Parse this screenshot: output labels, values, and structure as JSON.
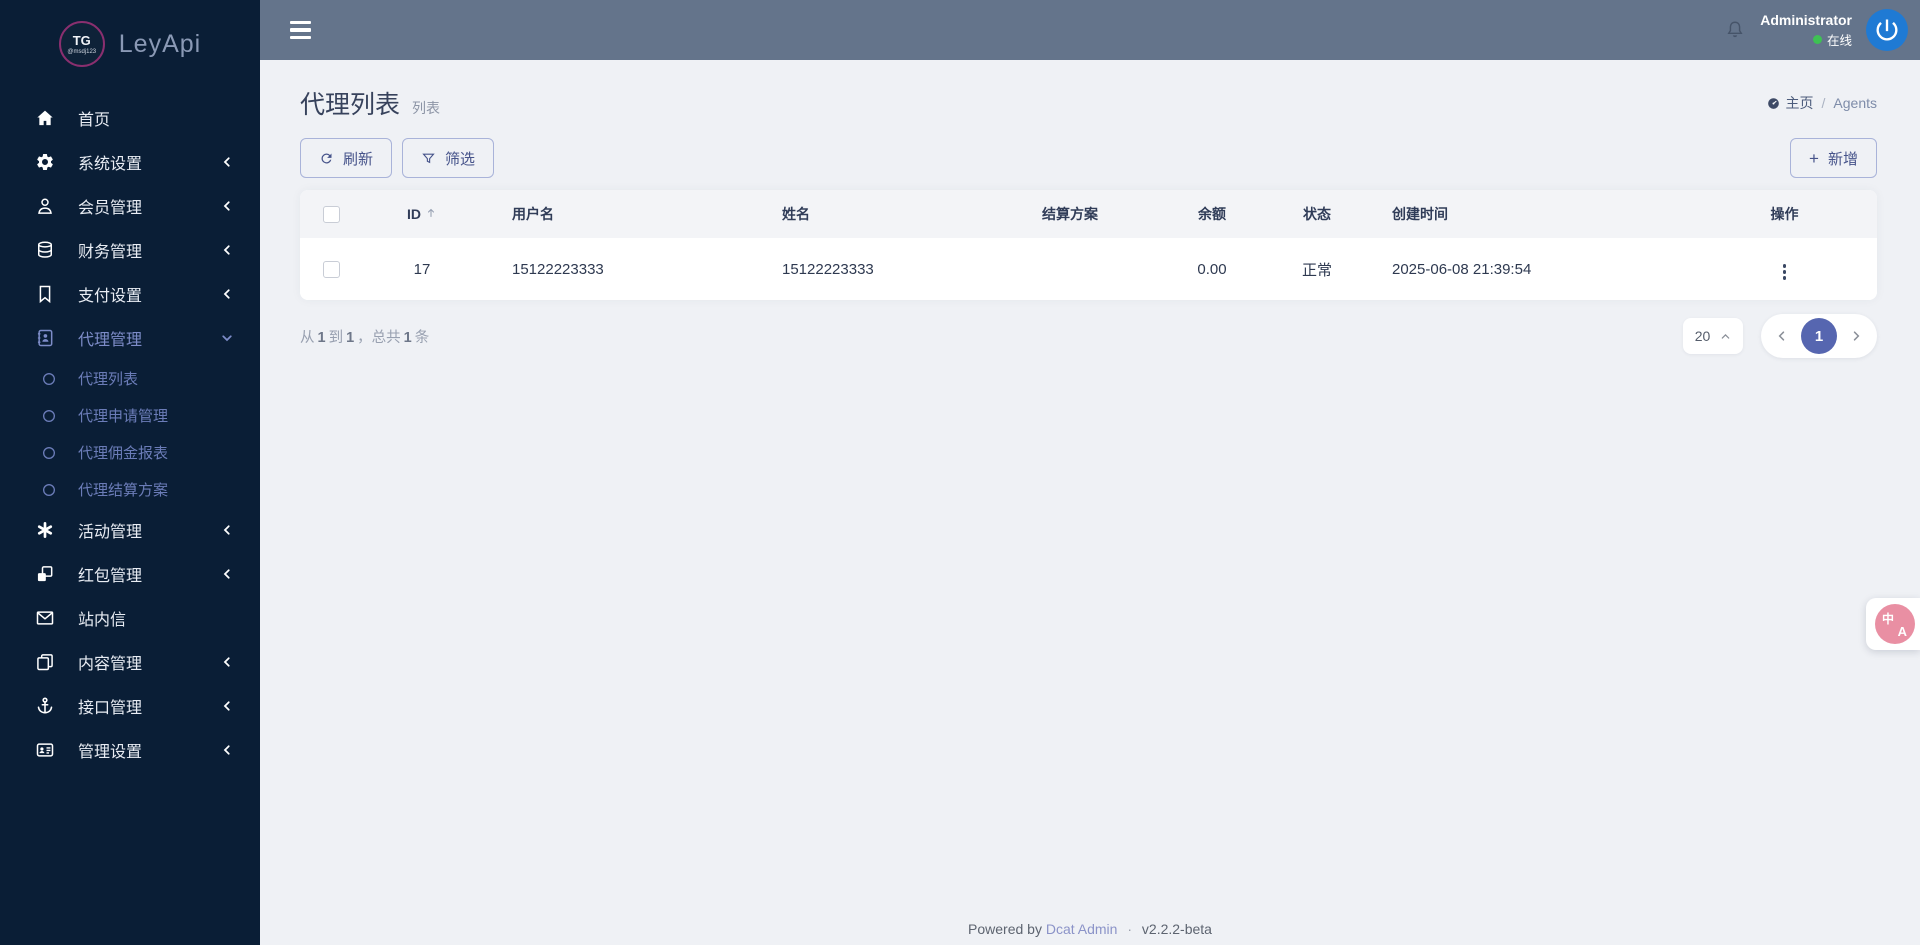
{
  "brand": {
    "badge_top": "TG",
    "badge_sub": "@msdj123",
    "app_name": "LeyApi"
  },
  "topbar": {
    "menu_icon": "hamburger-icon",
    "notification_icon": "bell-icon",
    "user_name": "Administrator",
    "online_status": "在线",
    "avatar_icon": "power-logo-icon"
  },
  "sidebar": {
    "items": [
      {
        "label": "首页",
        "icon": "home-icon"
      },
      {
        "label": "系统设置",
        "icon": "gears-icon"
      },
      {
        "label": "会员管理",
        "icon": "user-icon"
      },
      {
        "label": "财务管理",
        "icon": "database-icon"
      },
      {
        "label": "支付设置",
        "icon": "bookmark-icon"
      },
      {
        "label": "代理管理",
        "icon": "address-book-icon",
        "expanded": true,
        "active": true,
        "children": [
          {
            "label": "代理列表",
            "active": true
          },
          {
            "label": "代理申请管理"
          },
          {
            "label": "代理佣金报表"
          },
          {
            "label": "代理结算方案"
          }
        ]
      },
      {
        "label": "活动管理",
        "icon": "asterisk-icon"
      },
      {
        "label": "红包管理",
        "icon": "cubes-icon"
      },
      {
        "label": "站内信",
        "icon": "envelope-icon"
      },
      {
        "label": "内容管理",
        "icon": "copy-icon"
      },
      {
        "label": "接口管理",
        "icon": "anchor-icon"
      },
      {
        "label": "管理设置",
        "icon": "id-card-icon"
      }
    ]
  },
  "page": {
    "title": "代理列表",
    "subtitle": "列表",
    "breadcrumb": {
      "home_icon": "dashboard-icon",
      "home": "主页",
      "separator": "/",
      "current": "Agents"
    }
  },
  "toolbar": {
    "refresh_label": "刷新",
    "filter_label": "筛选",
    "create_label": "新增",
    "plus": "+"
  },
  "table": {
    "columns": {
      "id": "ID",
      "username": "用户名",
      "name": "姓名",
      "plan": "结算方案",
      "balance": "余额",
      "status": "状态",
      "created_at": "创建时间",
      "actions": "操作"
    },
    "rows": [
      {
        "id": "17",
        "username": "15122223333",
        "name": "15122223333",
        "plan": "",
        "balance": "0.00",
        "status": "正常",
        "created_at": "2025-06-08 21:39:54"
      }
    ]
  },
  "pagination": {
    "from_label": "从",
    "from": "1",
    "to_label": "到",
    "to": "1",
    "comma": "，",
    "total_label": "总共",
    "total": "1",
    "unit_label": "条",
    "page_size": "20",
    "current_page": "1"
  },
  "translate_fab": {
    "zh": "中",
    "en": "A"
  },
  "footer": {
    "powered_by": "Powered by",
    "link": "Dcat Admin",
    "separator": "·",
    "version": "v2.2.2-beta"
  },
  "colors": {
    "sidebar_bg": "#0a1e36",
    "topbar_bg": "#64748b",
    "page_bg": "#eff1f5",
    "accent": "#5666b0",
    "active_menu": "#7d8cc8",
    "online_green": "#3ec153",
    "avatar_blue": "#1f7ad4",
    "fab_pink": "#e98fa3",
    "button_border": "#a9b3d9",
    "button_text": "#46538a"
  }
}
